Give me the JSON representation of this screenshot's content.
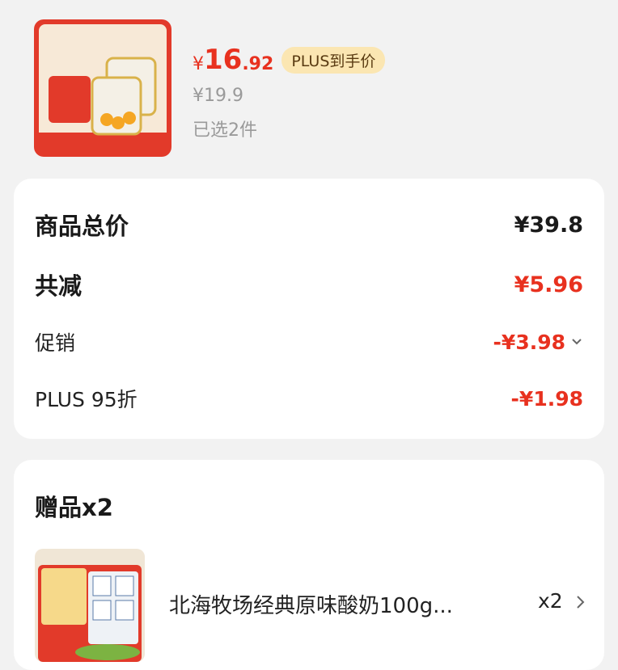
{
  "product": {
    "image_name": "yellow-peach-yogurt-image",
    "price_yen": "¥",
    "price_int": "16",
    "price_dec": ".92",
    "plus_badge": "PLUS到手价",
    "original_price": "¥19.9",
    "selected": "已选2件"
  },
  "summary": {
    "total_label": "商品总价",
    "total_value": "¥39.8",
    "reduce_label": "共减",
    "reduce_value": "¥5.96",
    "promo_label": "促销",
    "promo_value": "-¥3.98",
    "plus_label": "PLUS 95折",
    "plus_value": "-¥1.98"
  },
  "gift": {
    "title": "赠品x2",
    "name": "北海牧场经典原味酸奶100g...",
    "qty": "x2"
  },
  "colors": {
    "accent_red": "#e8311f",
    "badge_gold": "#fbe6b2"
  }
}
